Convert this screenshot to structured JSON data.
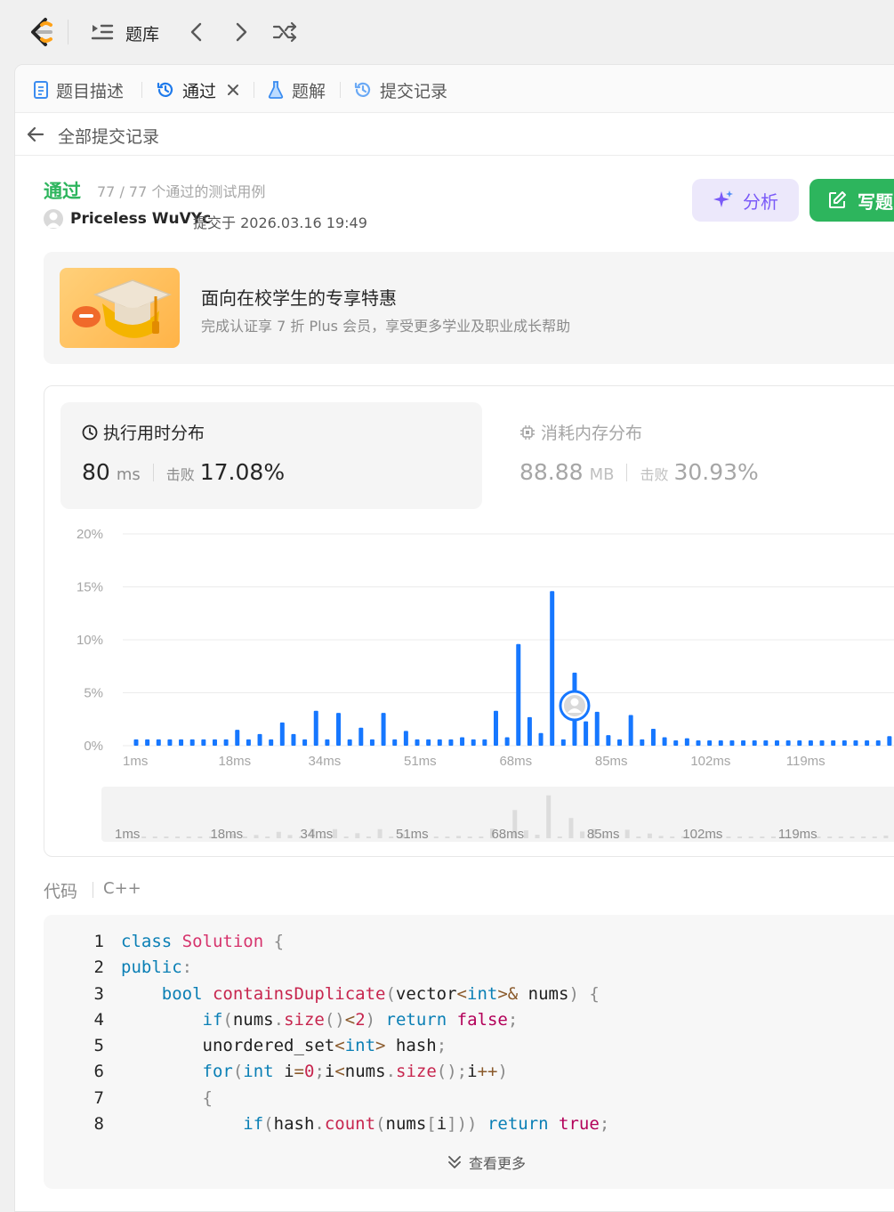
{
  "nav": {
    "title": "题库"
  },
  "tabs": [
    {
      "label": "题目描述"
    },
    {
      "label": "通过"
    },
    {
      "label": "题解"
    },
    {
      "label": "提交记录"
    }
  ],
  "back": {
    "label": "全部提交记录"
  },
  "submission": {
    "status": "通过",
    "testcases": "77 / 77 个通过的测试用例",
    "user": "Priceless WuVYc",
    "submitted_at": "提交于 2026.03.16 19:49"
  },
  "buttons": {
    "analyze": "分析",
    "write": "写题"
  },
  "promo": {
    "title": "面向在校学生的专享特惠",
    "subtitle": "完成认证享 7 折 Plus 会员，享受更多学业及职业成长帮助"
  },
  "runtime": {
    "title": "执行用时分布",
    "value": "80",
    "unit": "ms",
    "beat_label": "击败",
    "beat": "17.08%"
  },
  "memory": {
    "title": "消耗内存分布",
    "value": "88.88",
    "unit": "MB",
    "beat_label": "击败",
    "beat": "30.93%"
  },
  "chart_data": {
    "type": "bar",
    "y_ticks": [
      "20%",
      "15%",
      "10%",
      "5%",
      "0%"
    ],
    "ylim": [
      0,
      20
    ],
    "x_tick_labels": [
      "1ms",
      "18ms",
      "34ms",
      "51ms",
      "68ms",
      "85ms",
      "102ms",
      "119ms"
    ],
    "x_tick_ms": [
      1,
      18,
      34,
      51,
      68,
      85,
      102,
      119
    ],
    "series": [
      {
        "x": [
          1,
          3,
          5,
          7,
          9,
          11,
          13,
          15,
          17,
          19,
          21,
          23,
          25,
          27,
          29,
          31,
          33,
          35,
          37,
          39,
          41,
          43,
          45,
          47,
          49,
          51,
          53,
          55,
          57,
          59,
          61,
          63,
          65,
          67,
          69,
          71,
          73,
          75,
          77,
          79,
          81,
          83,
          85,
          87,
          89,
          91,
          93,
          95,
          97,
          99,
          101,
          103,
          105,
          107,
          109,
          111,
          113,
          115,
          117,
          119,
          121,
          123,
          125,
          127,
          129,
          131,
          133,
          135,
          137
        ],
        "values": [
          0.6,
          0.6,
          0.6,
          0.6,
          0.6,
          0.6,
          0.6,
          0.6,
          0.6,
          1.5,
          0.6,
          1.1,
          0.6,
          2.2,
          1.1,
          0.6,
          3.3,
          0.6,
          3.1,
          0.6,
          1.7,
          0.6,
          3.1,
          0.6,
          1.4,
          0.6,
          0.6,
          0.6,
          0.6,
          0.8,
          0.6,
          0.6,
          3.3,
          0.8,
          9.6,
          2.7,
          1.2,
          14.6,
          0.6,
          6.9,
          2.3,
          3.2,
          1.0,
          0.6,
          2.9,
          0.6,
          1.6,
          0.8,
          0.5,
          0.7,
          0.5,
          0.5,
          0.5,
          0.5,
          0.5,
          0.5,
          0.5,
          0.5,
          0.5,
          0.5,
          0.5,
          0.5,
          0.5,
          0.5,
          0.5,
          0.5,
          0.5,
          0.9,
          1.2
        ]
      }
    ],
    "scrubber_x_tick_labels": [
      "1ms",
      "18ms",
      "34ms",
      "51ms",
      "68ms",
      "85ms",
      "102ms",
      "119ms"
    ],
    "user_marker_ms": 79
  },
  "code": {
    "label": "代码",
    "language": "C++",
    "line_numbers": [
      "1",
      "2",
      "3",
      "4",
      "5",
      "6",
      "7",
      "8"
    ],
    "more_label": "查看更多"
  }
}
